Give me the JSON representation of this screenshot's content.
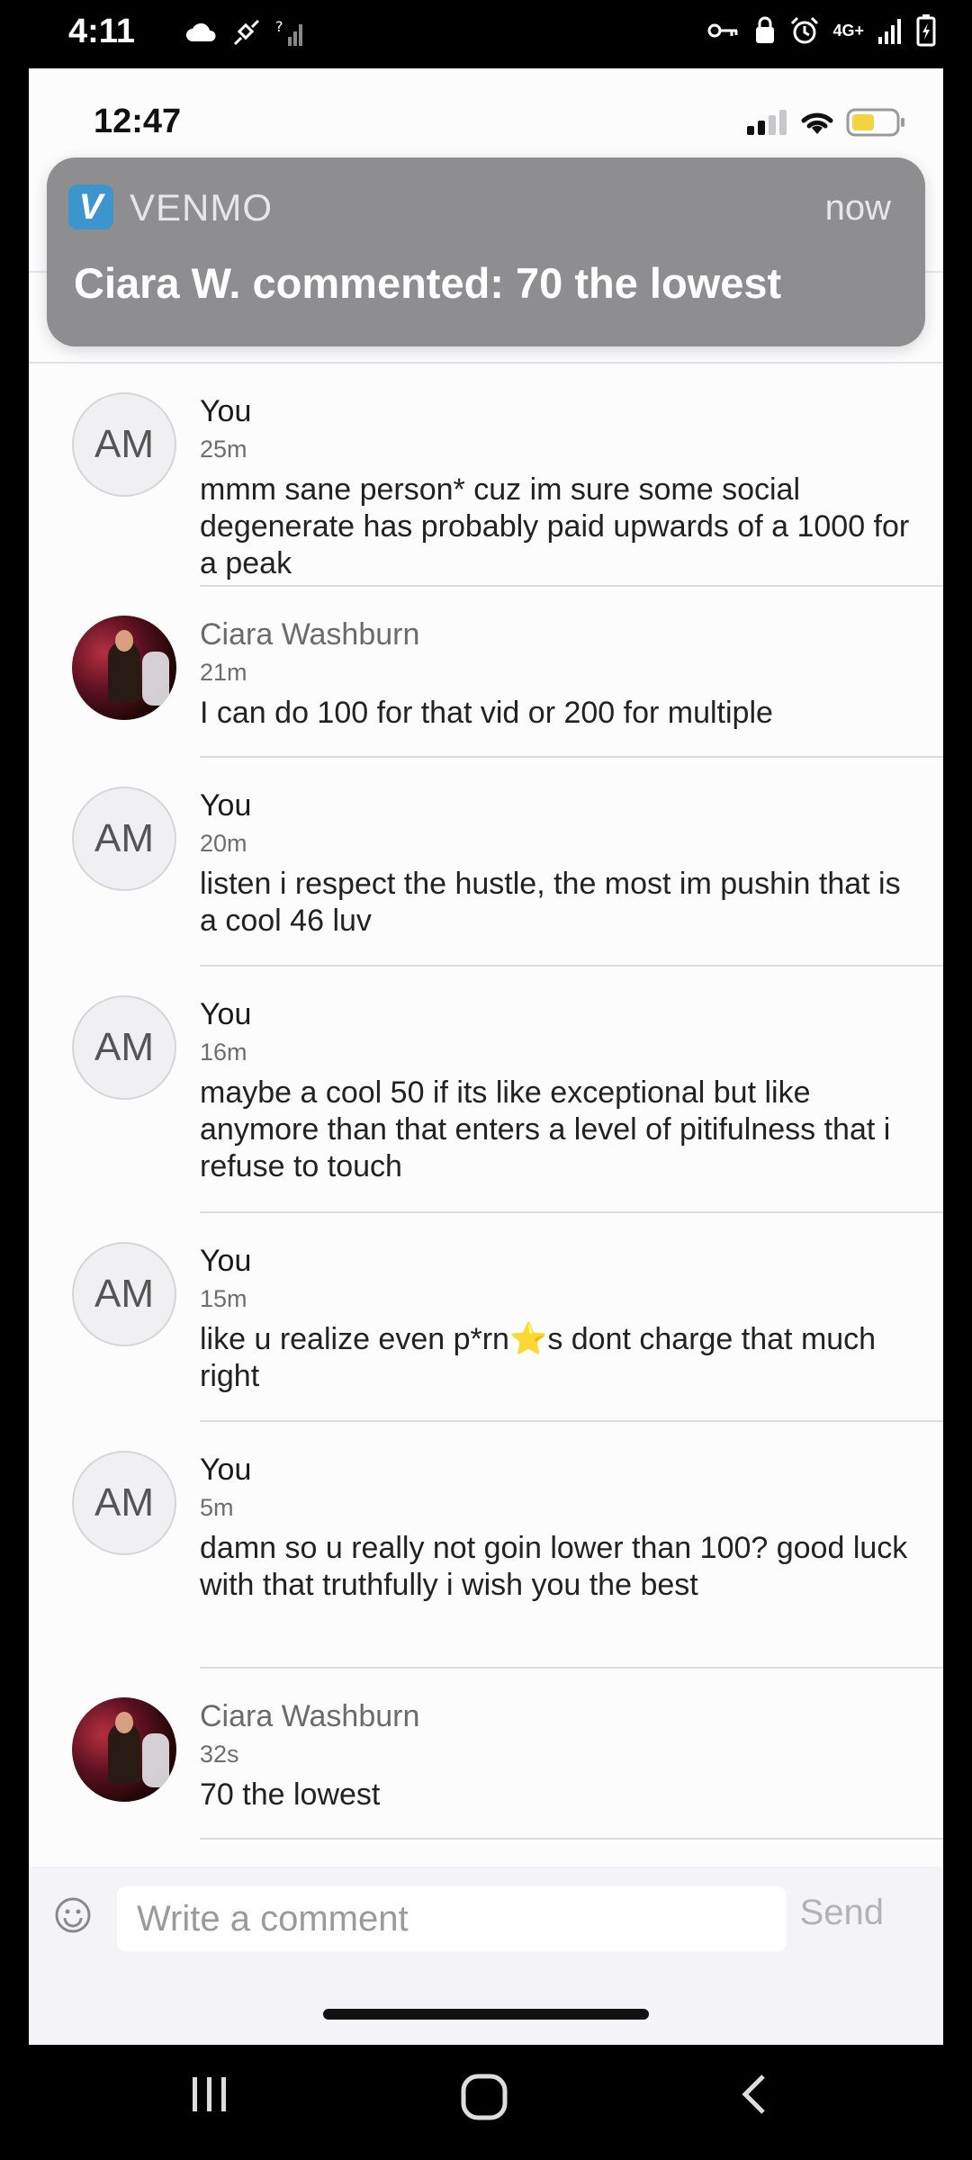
{
  "android_status": {
    "time": "4:11",
    "left_icons": [
      "cloud-icon",
      "satellite-icon",
      "signal-no-data-icon"
    ],
    "right_icons": [
      "vpn-key-icon",
      "lock-icon",
      "alarm-icon",
      "4g-icon",
      "signal-icon",
      "battery-charging-icon"
    ],
    "network": "4G+"
  },
  "ios_status": {
    "time": "12:47"
  },
  "notification": {
    "app_icon_letter": "V",
    "app_name": "VENMO",
    "time": "now",
    "message": "Ciara W. commented: 70 the lowest"
  },
  "comments": [
    {
      "avatar": "AM",
      "author": "You",
      "time": "25m",
      "text": "mmm sane person* cuz im sure some social degenerate has probably paid upwards of a 1000 for a peak",
      "is_you": true
    },
    {
      "avatar": "photo",
      "author": "Ciara Washburn",
      "time": "21m",
      "text": "I can do 100 for that vid or 200 for multiple",
      "is_you": false
    },
    {
      "avatar": "AM",
      "author": "You",
      "time": "20m",
      "text": "listen i respect the hustle, the most im pushin that is a cool 46 luv",
      "is_you": true
    },
    {
      "avatar": "AM",
      "author": "You",
      "time": "16m",
      "text": "maybe a cool 50 if its like exceptional but like anymore than that enters a level of pitifulness that i refuse to touch",
      "is_you": true
    },
    {
      "avatar": "AM",
      "author": "You",
      "time": "15m",
      "text_before": "like u realize even p*rn",
      "text_emoji": "⭐",
      "text_after": "s dont charge that much right",
      "is_you": true
    },
    {
      "avatar": "AM",
      "author": "You",
      "time": "5m",
      "text": "damn so u really not goin lower than 100? good luck with that truthfully i wish you the best",
      "is_you": true
    },
    {
      "avatar": "photo",
      "author": "Ciara Washburn",
      "time": "32s",
      "text": "70 the lowest",
      "is_you": false
    }
  ],
  "input": {
    "placeholder": "Write a comment",
    "value": "",
    "send_label": "Send"
  },
  "colors": {
    "venmo_blue": "#3d95ce",
    "banner_bg": "#8e8e90",
    "battery_yellow": "#f5d33f"
  }
}
